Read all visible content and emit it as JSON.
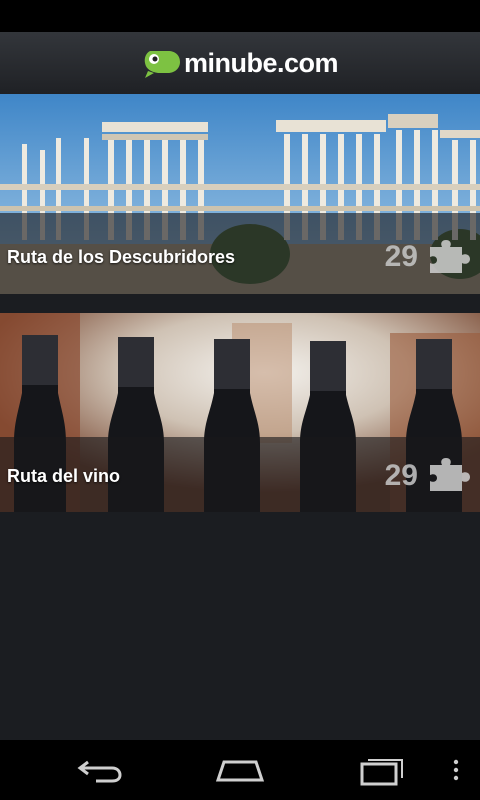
{
  "app": {
    "logo_text": "minube.com",
    "logo_icon": "speech-bubble-logo",
    "brand_color": "#7dc242"
  },
  "routes": [
    {
      "title": "Ruta de los Descubridores",
      "count": "29",
      "icon": "puzzle-icon",
      "image": "roman-theatre-columns"
    },
    {
      "title": "Ruta del vino",
      "count": "29",
      "icon": "puzzle-icon",
      "image": "wine-bottles"
    }
  ],
  "navbar": {
    "back_icon": "back-icon",
    "home_icon": "home-icon",
    "recent_icon": "recent-apps-icon",
    "menu_icon": "overflow-menu-icon"
  }
}
